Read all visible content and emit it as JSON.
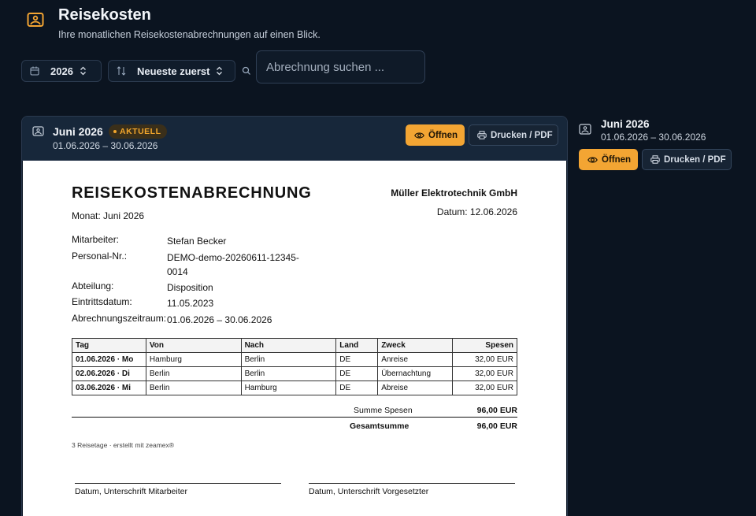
{
  "header": {
    "title": "Reisekosten",
    "subtitle": "Ihre monatlichen Reisekostenabrechnungen auf einen Blick."
  },
  "toolbar": {
    "year": "2026",
    "sort": "Neueste zuerst",
    "search_placeholder": "Abrechnung suchen ..."
  },
  "card": {
    "title": "Juni 2026",
    "badge": "AKTUELL",
    "range": "01.06.2026 – 30.06.2026",
    "open_label": "Öffnen",
    "print_label": "Drucken / PDF"
  },
  "document": {
    "title": "REISEKOSTENABRECHNUNG",
    "month": "Monat: Juni 2026",
    "company": "Müller Elektrotechnik GmbH",
    "date": "Datum: 12.06.2026",
    "fields": [
      {
        "key": "Mitarbeiter:",
        "value": "Stefan Becker"
      },
      {
        "key": "Personal-Nr.:",
        "value": "DEMO-demo-20260611-12345-0014"
      },
      {
        "key": "Abteilung:",
        "value": "Disposition"
      },
      {
        "key": "Eintrittsdatum:",
        "value": "11.05.2023"
      },
      {
        "key": "Abrechnungszeitraum:",
        "value": "01.06.2026 – 30.06.2026"
      }
    ],
    "table": {
      "headers": [
        "Tag",
        "Von",
        "Nach",
        "Land",
        "Zweck",
        "Spesen"
      ],
      "rows": [
        [
          "01.06.2026 · Mo",
          "Hamburg",
          "Berlin",
          "DE",
          "Anreise",
          "32,00 EUR"
        ],
        [
          "02.06.2026 · Di",
          "Berlin",
          "Berlin",
          "DE",
          "Übernachtung",
          "32,00 EUR"
        ],
        [
          "03.06.2026 · Mi",
          "Berlin",
          "Hamburg",
          "DE",
          "Abreise",
          "32,00 EUR"
        ]
      ]
    },
    "sum_label": "Summe Spesen",
    "sum_value": "96,00 EUR",
    "total_label": "Gesamtsumme",
    "total_value": "96,00 EUR",
    "footer_note": "3 Reisetage · erstellt mit zeamex®",
    "sig_employee": "Datum, Unterschrift Mitarbeiter",
    "sig_supervisor": "Datum, Unterschrift Vorgesetzter"
  },
  "side": {
    "title": "Juni 2026",
    "range": "01.06.2026 – 30.06.2026",
    "open_label": "Öffnen",
    "print_label": "Drucken / PDF"
  },
  "colors": {
    "background": "#0b1420",
    "accent": "#f3a533",
    "card_header": "#17273a"
  }
}
